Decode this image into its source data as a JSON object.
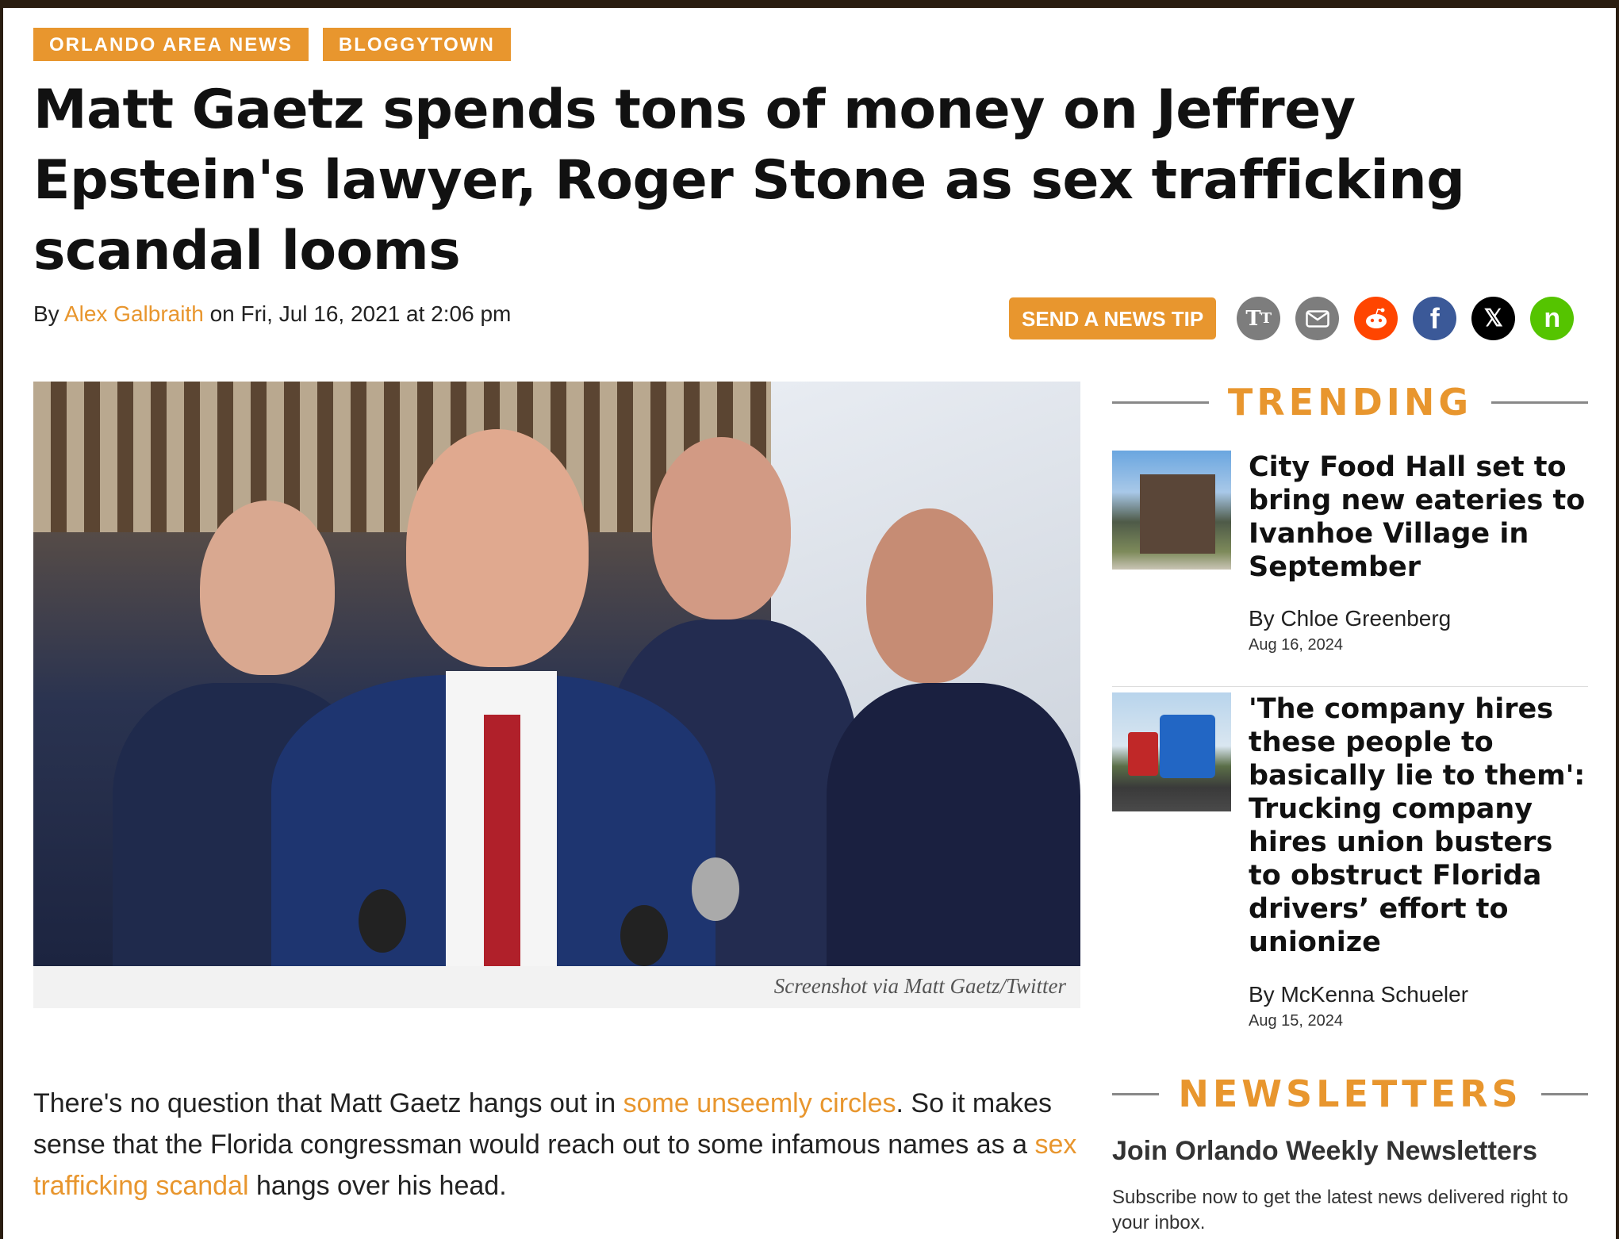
{
  "tags": [
    "Orlando Area News",
    "Bloggytown"
  ],
  "headline": "Matt Gaetz spends tons of money on Jeffrey Epstein's lawyer, Roger Stone as sex trafficking scandal looms",
  "byline": {
    "prefix": "By ",
    "author": "Alex Galbraith",
    "date": " on Fri, Jul 16, 2021 at 2:06 pm"
  },
  "actions": {
    "tip_label": "SEND A NEWS TIP",
    "icons": [
      "text-size-icon",
      "email-icon",
      "reddit-icon",
      "facebook-icon",
      "x-icon",
      "nextdoor-icon"
    ]
  },
  "hero": {
    "caption": "Screenshot via Matt Gaetz/Twitter"
  },
  "body": {
    "t1": "There's no question that Matt Gaetz hangs out in ",
    "l1": "some unseemly circles",
    "t2": ". So it makes sense that the Florida congressman would reach out to some infamous names as a ",
    "l2": "sex trafficking scandal",
    "t3": " hangs over his head."
  },
  "sidebar": {
    "trending_label": "TRENDING",
    "items": [
      {
        "title": "City Food Hall set to bring new eateries to Ivanhoe Village in September",
        "author": "By Chloe Greenberg",
        "date": "Aug 16, 2024"
      },
      {
        "title": "'The company hires these people to basically lie to them': Trucking company hires union busters to obstruct Florida drivers’ effort to unionize",
        "author": "By McKenna Schueler",
        "date": "Aug 15, 2024"
      }
    ],
    "newsletters_label": "NEWSLETTERS",
    "newsletter_title": "Join Orlando Weekly Newsletters",
    "newsletter_desc": "Subscribe now to get the latest news delivered right to your inbox."
  },
  "colors": {
    "accent": "#e8962e",
    "reddit": "#ff4500",
    "facebook": "#3b5998",
    "nextdoor": "#55c400"
  }
}
